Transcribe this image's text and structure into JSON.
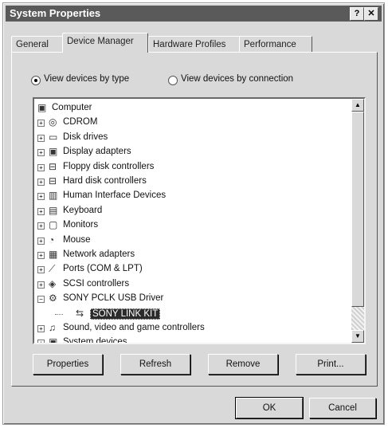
{
  "window": {
    "title": "System Properties",
    "help_glyph": "?",
    "close_glyph": "✕"
  },
  "tabs": [
    "General",
    "Device Manager",
    "Hardware Profiles",
    "Performance"
  ],
  "view": {
    "by_type": "View devices by type",
    "by_connection": "View devices by connection",
    "selected": "by_type"
  },
  "tree": {
    "root": "Computer",
    "items": [
      {
        "label": "CDROM",
        "icon": "cdrom-icon",
        "glyph": "◎",
        "expander": "+"
      },
      {
        "label": "Disk drives",
        "icon": "disk-drive-icon",
        "glyph": "▭",
        "expander": "+"
      },
      {
        "label": "Display adapters",
        "icon": "display-adapter-icon",
        "glyph": "▣",
        "expander": "+"
      },
      {
        "label": "Floppy disk controllers",
        "icon": "floppy-controller-icon",
        "glyph": "⊟",
        "expander": "+"
      },
      {
        "label": "Hard disk controllers",
        "icon": "hard-disk-controller-icon",
        "glyph": "⊟",
        "expander": "+"
      },
      {
        "label": "Human Interface Devices",
        "icon": "hid-icon",
        "glyph": "▥",
        "expander": "+"
      },
      {
        "label": "Keyboard",
        "icon": "keyboard-icon",
        "glyph": "▤",
        "expander": "+"
      },
      {
        "label": "Monitors",
        "icon": "monitor-icon",
        "glyph": "▢",
        "expander": "+"
      },
      {
        "label": "Mouse",
        "icon": "mouse-icon",
        "glyph": "◔",
        "expander": "+"
      },
      {
        "label": "Network adapters",
        "icon": "network-adapter-icon",
        "glyph": "▦",
        "expander": "+"
      },
      {
        "label": "Ports (COM & LPT)",
        "icon": "port-icon",
        "glyph": "⟋",
        "expander": "+"
      },
      {
        "label": "SCSI controllers",
        "icon": "scsi-icon",
        "glyph": "◈",
        "expander": "+"
      },
      {
        "label": "SONY PCLK USB Driver",
        "icon": "usb-driver-icon",
        "glyph": "⚙",
        "expander": "−"
      },
      {
        "label": "SONY LINK KIT",
        "icon": "usb-device-icon",
        "glyph": "⇆",
        "expander": "",
        "child": true,
        "selected": true
      },
      {
        "label": "Sound, video and game controllers",
        "icon": "sound-controller-icon",
        "glyph": "♫",
        "expander": "+"
      },
      {
        "label": "System devices",
        "icon": "system-device-icon",
        "glyph": "▣",
        "expander": "+"
      }
    ]
  },
  "buttons": {
    "properties": "Properties",
    "refresh": "Refresh",
    "remove": "Remove",
    "print": "Print...",
    "ok": "OK",
    "cancel": "Cancel"
  },
  "colors": {
    "face": "#d9d9d9",
    "titlebar": "#5a5a5a",
    "selection": "#2b2b2b"
  }
}
